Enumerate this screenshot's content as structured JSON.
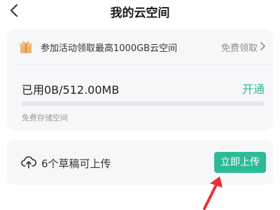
{
  "header": {
    "title": "我的云空间",
    "back_icon": "chevron-left-icon"
  },
  "promo": {
    "icon": "gift-icon",
    "text": "参加活动领取最高1000GB云空间",
    "link": "免费领取",
    "chevron_icon": "chevron-right-icon"
  },
  "storage": {
    "usage": "已用0B/512.00MB",
    "action": "开通",
    "label": "免费存储空间",
    "used_fraction": 0
  },
  "drafts": {
    "icon": "cloud-upload-icon",
    "text": "6个草稿可上传",
    "button": "立即上传"
  },
  "annotation": {
    "icon": "red-arrow-icon"
  },
  "colors": {
    "accent": "#2dbb97",
    "card_bg": "#f6f7f9",
    "arrow": "#e8303a",
    "gift": "#e9b56d"
  }
}
